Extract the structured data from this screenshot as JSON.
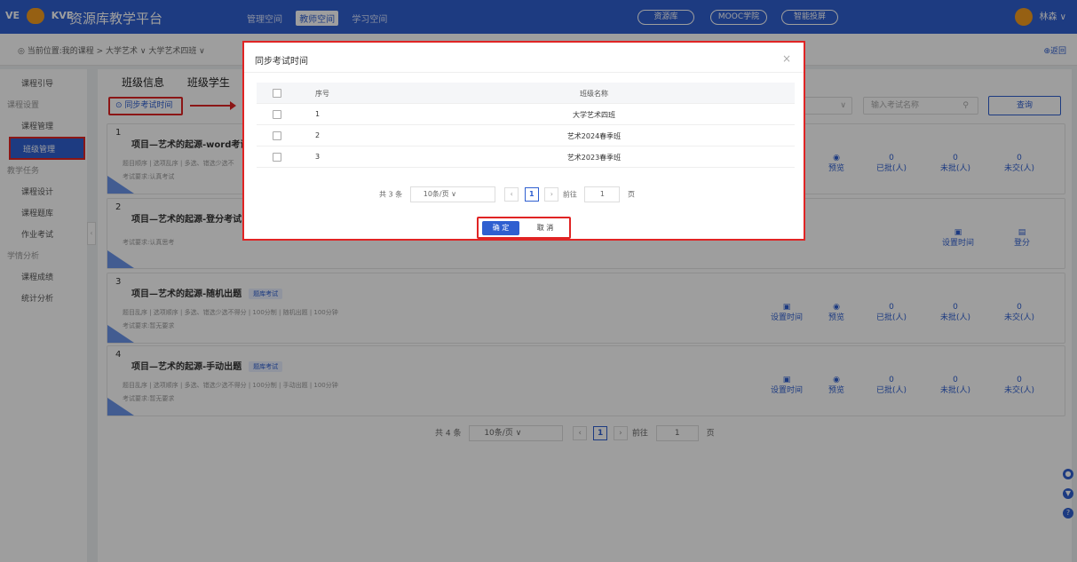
{
  "header": {
    "logo_text": "VE",
    "logo_text2": "KVE",
    "title": "资源库教学平台",
    "spaces": [
      "管理空间",
      "教师空间",
      "学习空间"
    ],
    "pills": [
      "资源库",
      "MOOC学院",
      "智能投屏"
    ],
    "user": "林森"
  },
  "breadcrumb": {
    "text": "当前位置:我的课程 > 大学艺术 ∨ 大学艺术四班 ∨",
    "back": "返回"
  },
  "sidebar": {
    "items": [
      "课程引导",
      "课程设置",
      "课程管理",
      "班级管理",
      "教学任务",
      "课程设计",
      "课程题库",
      "作业考试",
      "学情分析",
      "课程成绩",
      "统计分析"
    ]
  },
  "main": {
    "tabs": [
      "班级信息",
      "班级学生"
    ],
    "sync_button": "同步考试时间",
    "search_placeholder": "输入考试名称",
    "query_button": "查询",
    "exams": [
      {
        "num": "1",
        "title": "项目—艺术的起源-word考试模",
        "tag": "",
        "meta": "题目顺序 | 选项乱序 | 多选、错选少选不",
        "req": "考试要求:认真考试"
      },
      {
        "num": "2",
        "title": "项目—艺术的起源-登分考试",
        "tag": "",
        "meta": "",
        "req": "考试要求:认真思考"
      },
      {
        "num": "3",
        "title": "项目—艺术的起源-随机出题",
        "tag": "题库考试",
        "meta": "题目乱序 | 选项顺序 | 多选、错选少选不得分 | 100分制 | 随机出题 | 100分钟",
        "req": "考试要求:暂无要求"
      },
      {
        "num": "4",
        "title": "项目—艺术的起源-手动出题",
        "tag": "题库考试",
        "meta": "题目乱序 | 选项顺序 | 多选、错选少选不得分 | 100分制 | 手动出题 | 100分钟",
        "req": "考试要求:暂无要求"
      }
    ],
    "actions": {
      "set_time": "设置时间",
      "preview": "预览",
      "grade": "登分"
    },
    "stats": {
      "graded": "已批(人)",
      "ungraded": "未批(人)",
      "unsubmitted": "未交(人)",
      "zero": "0"
    },
    "pager": {
      "total": "共 4 条",
      "page_size": "10条/页",
      "current": "1",
      "goto": "前往",
      "goto_value": "1",
      "page_unit": "页"
    }
  },
  "modal": {
    "title": "同步考试时间",
    "headers": {
      "seq": "序号",
      "name": "班级名称"
    },
    "rows": [
      {
        "seq": "1",
        "name": "大学艺术四班"
      },
      {
        "seq": "2",
        "name": "艺术2024春季班"
      },
      {
        "seq": "3",
        "name": "艺术2023春季班"
      }
    ],
    "pager": {
      "total": "共 3 条",
      "page_size": "10条/页",
      "current": "1",
      "goto": "前往",
      "goto_value": "1",
      "page_unit": "页"
    },
    "ok": "确 定",
    "cancel": "取 消"
  }
}
